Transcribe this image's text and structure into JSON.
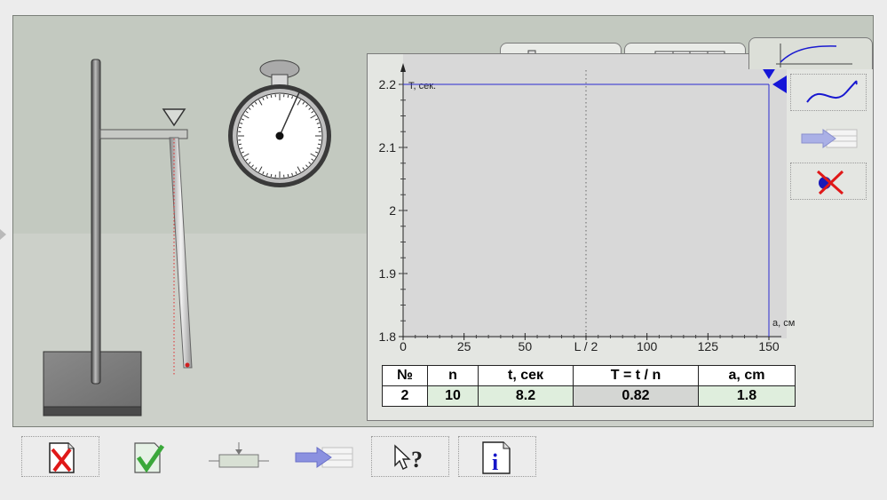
{
  "tabs": [
    {
      "name": "parameters",
      "icon": "slider-icon",
      "active": false
    },
    {
      "name": "table",
      "icon": "table-icon",
      "active": false
    },
    {
      "name": "graph",
      "icon": "graph-icon",
      "active": true
    }
  ],
  "chart_data": {
    "type": "scatter",
    "ylabel": "T, сек.",
    "xlabel": "a, см",
    "x_ticks": [
      "0",
      "25",
      "50",
      "L / 2",
      "100",
      "125",
      "150"
    ],
    "y_ticks": [
      "1.8",
      "1.9",
      "2",
      "2.1",
      "2.2"
    ],
    "xlim": [
      0,
      150
    ],
    "ylim": [
      1.8,
      2.2
    ],
    "grid": false,
    "reference_line_x": "L / 2",
    "cursor": {
      "x": 150,
      "y": 2.2
    },
    "points": []
  },
  "table": {
    "headers": [
      "№",
      "n",
      "t, сек",
      "T = t / n",
      "a, cm"
    ],
    "row": [
      "2",
      "10",
      "8.2",
      "0.82",
      "1.8"
    ]
  },
  "side_buttons": [
    {
      "name": "fit-curve",
      "icon": "curve-icon"
    },
    {
      "name": "transfer-to-table",
      "icon": "arrow-table-icon"
    },
    {
      "name": "delete-point",
      "icon": "delete-point-icon"
    }
  ],
  "toolbar": [
    {
      "name": "reset",
      "icon": "reset-icon"
    },
    {
      "name": "check",
      "icon": "check-icon"
    },
    {
      "name": "measure",
      "icon": "measure-icon"
    },
    {
      "name": "record",
      "icon": "record-icon"
    },
    {
      "name": "help",
      "icon": "help-icon"
    },
    {
      "name": "info",
      "icon": "info-icon"
    }
  ],
  "colors": {
    "accent_blue": "#1616d8",
    "cursor_line": "#2a2ad0",
    "cancel_red": "#e01818",
    "check_green": "#3aa83a"
  }
}
